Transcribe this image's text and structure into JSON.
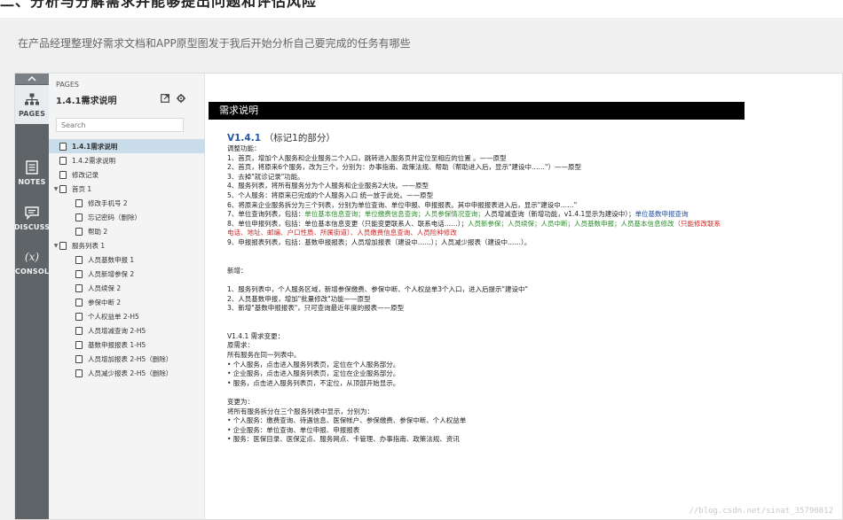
{
  "top_heading": "二、分析与分解需求并能够提出问题和评估风险",
  "caption": "在产品经理整理好需求文档和APP原型图发于我后开始分析自己要完成的任务有哪些",
  "iconbar": {
    "collapse_icon": "chevron-up-icon",
    "items": [
      {
        "label": "PAGES",
        "icon": "sitemap-icon"
      },
      {
        "label": "NOTES",
        "icon": "notes-icon"
      },
      {
        "label": "DISCUSS",
        "icon": "discuss-icon"
      },
      {
        "label": "CONSOL",
        "icon": "function-icon",
        "glyph": "(x)"
      }
    ]
  },
  "sidebar": {
    "label": "PAGES",
    "title": "1.4.1需求说明",
    "search_placeholder": "Search",
    "tree": [
      {
        "label": "1.4.1需求说明",
        "selected": true,
        "bold": true
      },
      {
        "label": "1.4.2需求说明"
      },
      {
        "label": "修改记录"
      },
      {
        "label": "首页 1",
        "arrow": "▼"
      },
      {
        "label": "修改手机号 2",
        "indent": 1
      },
      {
        "label": "忘记密码（删除）",
        "indent": 1
      },
      {
        "label": "帮助 2",
        "indent": 1
      },
      {
        "label": "服务列表 1",
        "arrow": "▼"
      },
      {
        "label": "人员基数申报 1",
        "indent": 1
      },
      {
        "label": "人员新增参保 2",
        "indent": 1
      },
      {
        "label": "人员续保 2",
        "indent": 1
      },
      {
        "label": "参保中断 2",
        "indent": 1
      },
      {
        "label": "个人权益单 2-H5",
        "indent": 1
      },
      {
        "label": "人员增减查询 2-H5",
        "indent": 1
      },
      {
        "label": "基数申报报表 1-H5",
        "indent": 1
      },
      {
        "label": "人员增加报表 2-H5（删除）",
        "indent": 1
      },
      {
        "label": "人员减少报表 2-H5（删除）",
        "indent": 1
      }
    ]
  },
  "content": {
    "banner": "需求说明",
    "version": "V1.4.1",
    "version_note": "（标记1的部分）",
    "adjust_title": "调整功能：",
    "adjust": {
      "l1": "1、首页，增加个人服务和企业服务二个入口，跳转进入服务页并定位至相应的位置 。——原型",
      "l2": "2、首页，将原来6个服务，改为三个，分别为：办事指南、政策法规、帮助（帮助进入后，显示\"建设中……\"）——原型",
      "l3": "3、去掉\"就诊记录\"功能。",
      "l4": "4、服务列表，将所有服务分为个人服务和企业服务2大块。——原型",
      "l5": "5、个人服务：将原来已完成的个人服务入口 统一放于此处。——原型",
      "l6": "6、将原来企业服务拆分为三个列表，分别为单位查询、单位申报、申报报表。其中申报报表进入后，显示\"建设中……\"",
      "l7a": "7、单位查询列表，包括：",
      "l7b": "单位基本信息查询；单位缴费信息查询；人员参保情况查询；",
      "l7c": "人员增减查询（新增功能，v1.4.1显示为建设中）；",
      "l7d": "单位基数申报查询",
      "l8a": "8、单位申报列表，包括：单位基本信息变更（只能变更联系人、联系电话……）；",
      "l8b": "人员新参保；人员续保；人员中断；人员基数申报；人员基本信息修改",
      "l8c": "（只能修改联系电话、地址、邮编、户口性质、所属街道）、",
      "l8d": "人员缴费信息查询、人员险种修改",
      "l9": "9、申报报表列表，包括：基数申报报表；人员增加报表（建设中……）；人员减少报表（建设中……）。"
    },
    "new_title": "新增：",
    "new": {
      "l1": "1、服务列表中，个人服务区域，新增参保缴费、参保中断、个人权益单3个入口，进入后提示\"建设中\"",
      "l2": "2、人员基数申报，增加\"批量修改\"功能——原型",
      "l3": "3、新增\"基数申报报表\"，只可查询最近年度的报表——原型"
    },
    "change": {
      "title": "V1.4.1 需求变更：",
      "orig": "原需求：",
      "p1": "所有服务在同一列表中。",
      "b1": "• 个人服务，点击进入服务列表页，定位在个人服务部分。",
      "b2": "• 企业服务，点击进入服务列表页，定位在企业服务部分。",
      "b3": "• 服务，点击进入服务列表页，不定位，从顶部开始显示。",
      "changed": "变更为：",
      "p2": "将所有服务拆分在三个服务列表中显示，分别为：",
      "c1": "• 个人服务：缴费查询、待遇信息、医保帐户、参保缴费、参保中断、个人权益单",
      "c2": "• 企业服务：单位查询、单位申报、申报报表",
      "c3": "• 服务：医保目录、医保定点、服务网点、卡管理、办事指南、政策法规、资讯"
    },
    "watermark": "//blog.csdn.net/sinat_35790812"
  }
}
